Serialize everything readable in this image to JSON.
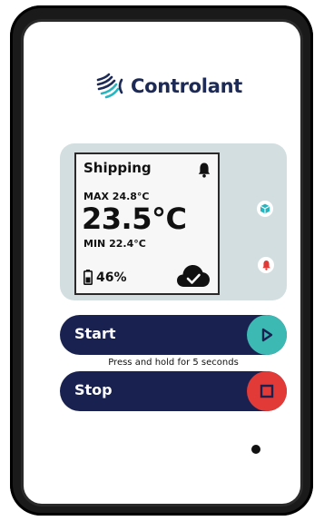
{
  "brand": {
    "name": "Controlant"
  },
  "screen": {
    "status": "Shipping",
    "max_label": "MAX",
    "max_value": "24.8°C",
    "current_temp": "23.5°C",
    "min_label": "MIN",
    "min_value": "22.4°C",
    "battery": "46%",
    "icons": [
      "bell-icon",
      "battery-icon",
      "cloud-check-icon"
    ]
  },
  "side_buttons": {
    "top_icon": "cube-icon",
    "bottom_icon": "bell-icon"
  },
  "start": {
    "label": "Start",
    "icon": "play-icon"
  },
  "hint": "Press and hold for 5 seconds",
  "stop": {
    "label": "Stop",
    "icon": "stop-icon"
  },
  "colors": {
    "brand_navy": "#1c2a55",
    "button_navy": "#182150",
    "start_teal": "#3cb9b3",
    "stop_red": "#e23a36",
    "panel": "#d3dee1",
    "cube_teal": "#27b6c0"
  }
}
